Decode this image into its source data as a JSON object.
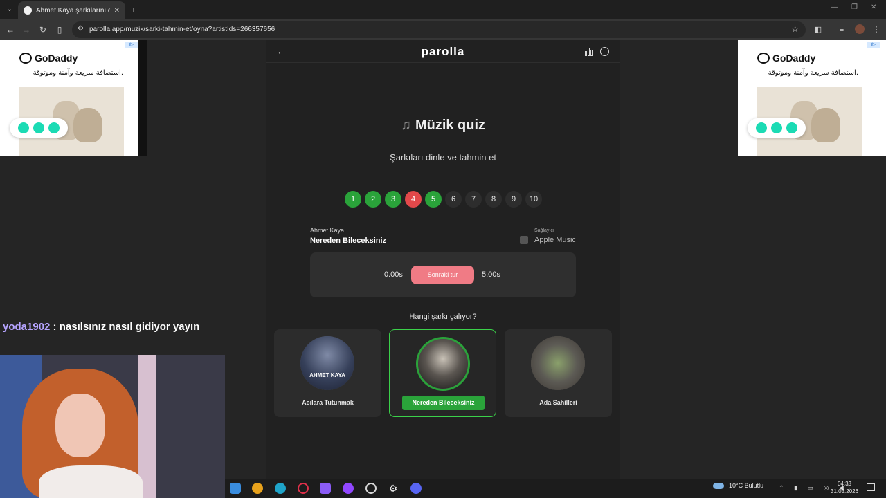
{
  "browser": {
    "tab_title": "Ahmet Kaya şarkılarını dinle ve",
    "url": "parolla.app/muzik/sarki-tahmin-et/oyna?artistIds=266357656"
  },
  "ads": {
    "brand": "GoDaddy",
    "tagline": "استضافة سريعة وآمنة وموثوقة."
  },
  "chat": {
    "username": "yoda1902",
    "message": " : nasılsınız nasıl gidiyor yayın"
  },
  "site": {
    "logo": "parolla"
  },
  "quiz": {
    "title": "Müzik quiz",
    "subtitle": "Şarkıları dinle ve tahmin et",
    "rounds": [
      {
        "label": "1",
        "status": "win"
      },
      {
        "label": "2",
        "status": "win"
      },
      {
        "label": "3",
        "status": "win"
      },
      {
        "label": "4",
        "status": "lose"
      },
      {
        "label": "5",
        "status": "win"
      },
      {
        "label": "6",
        "status": "pending"
      },
      {
        "label": "7",
        "status": "pending"
      },
      {
        "label": "8",
        "status": "pending"
      },
      {
        "label": "9",
        "status": "pending"
      },
      {
        "label": "10",
        "status": "pending"
      }
    ],
    "song_artist": "Ahmet Kaya",
    "song_title": "Nereden Bileceksiniz",
    "provider_label": "Sağlayıcı",
    "provider_name": "Apple Music",
    "time_elapsed": "0.00s",
    "next_button": "Sonraki tur",
    "time_total": "5.00s",
    "question": "Hangi şarkı çalıyor?",
    "options": [
      {
        "name": "Acılara Tutunmak",
        "cover_text": "AHMET KAYA",
        "correct": false
      },
      {
        "name": "Nereden Bileceksiniz",
        "correct": true
      },
      {
        "name": "Ada Sahilleri",
        "correct": false
      }
    ]
  },
  "tray": {
    "weather": "10°C  Bulutlu",
    "time": "04:33",
    "date": "31.03.2026"
  }
}
